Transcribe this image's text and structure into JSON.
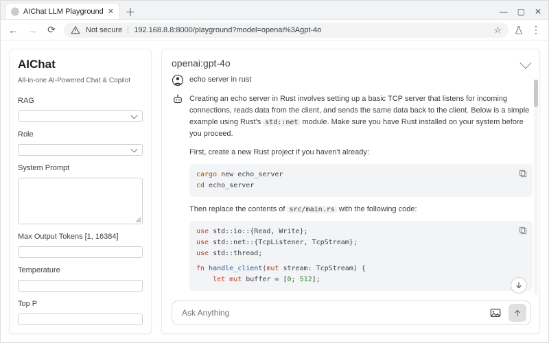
{
  "browser": {
    "tab_title": "AIChat LLM Playground",
    "not_secure_label": "Not secure",
    "url": "192.168.8.8:8000/playground?model=openai%3Agpt-4o"
  },
  "sidebar": {
    "title": "AIChat",
    "subtitle": "All-in-one AI-Powered Chat & Copilot",
    "rag_label": "RAG",
    "role_label": "Role",
    "system_prompt_label": "System Prompt",
    "max_tokens_label": "Max Output Tokens [1, 16384]",
    "temperature_label": "Temperature",
    "top_p_label": "Top P"
  },
  "main": {
    "model": "openai:gpt-4o",
    "user_prompt": "echo server in rust",
    "assistant_intro": "Creating an echo server in Rust involves setting up a basic TCP server that listens for incoming connections, reads data from the client, and sends the same data back to the client. Below is a simple example using Rust's ",
    "std_net": "std::net",
    "assistant_intro_tail": " module. Make sure you have Rust installed on your system before you proceed.",
    "first_step": "First, create a new Rust project if you haven't already:",
    "code1": {
      "l1_cmd": "cargo",
      "l1_rest": " new echo_server",
      "l2_cmd": "cd",
      "l2_rest": " echo_server"
    },
    "then_replace_head": "Then replace the contents of ",
    "src_main": "src/main.rs",
    "then_replace_tail": " with the following code:",
    "code2": {
      "l1a": "use",
      "l1b": " std::io::{Read, Write};",
      "l2a": "use",
      "l2b": " std::net::{TcpListener, TcpStream};",
      "l3a": "use",
      "l3b": " std::thread;",
      "l4a": "fn ",
      "l4b": "handle_client",
      "l4c": "(",
      "l4d": "mut",
      "l4e": " stream: TcpStream) {",
      "l5a": "    let ",
      "l5b": "mut",
      "l5c": " buffer = [",
      "l5d": "0",
      "l5e": "; ",
      "l5f": "512",
      "l5g": "];"
    },
    "input_placeholder": "Ask Anything"
  }
}
